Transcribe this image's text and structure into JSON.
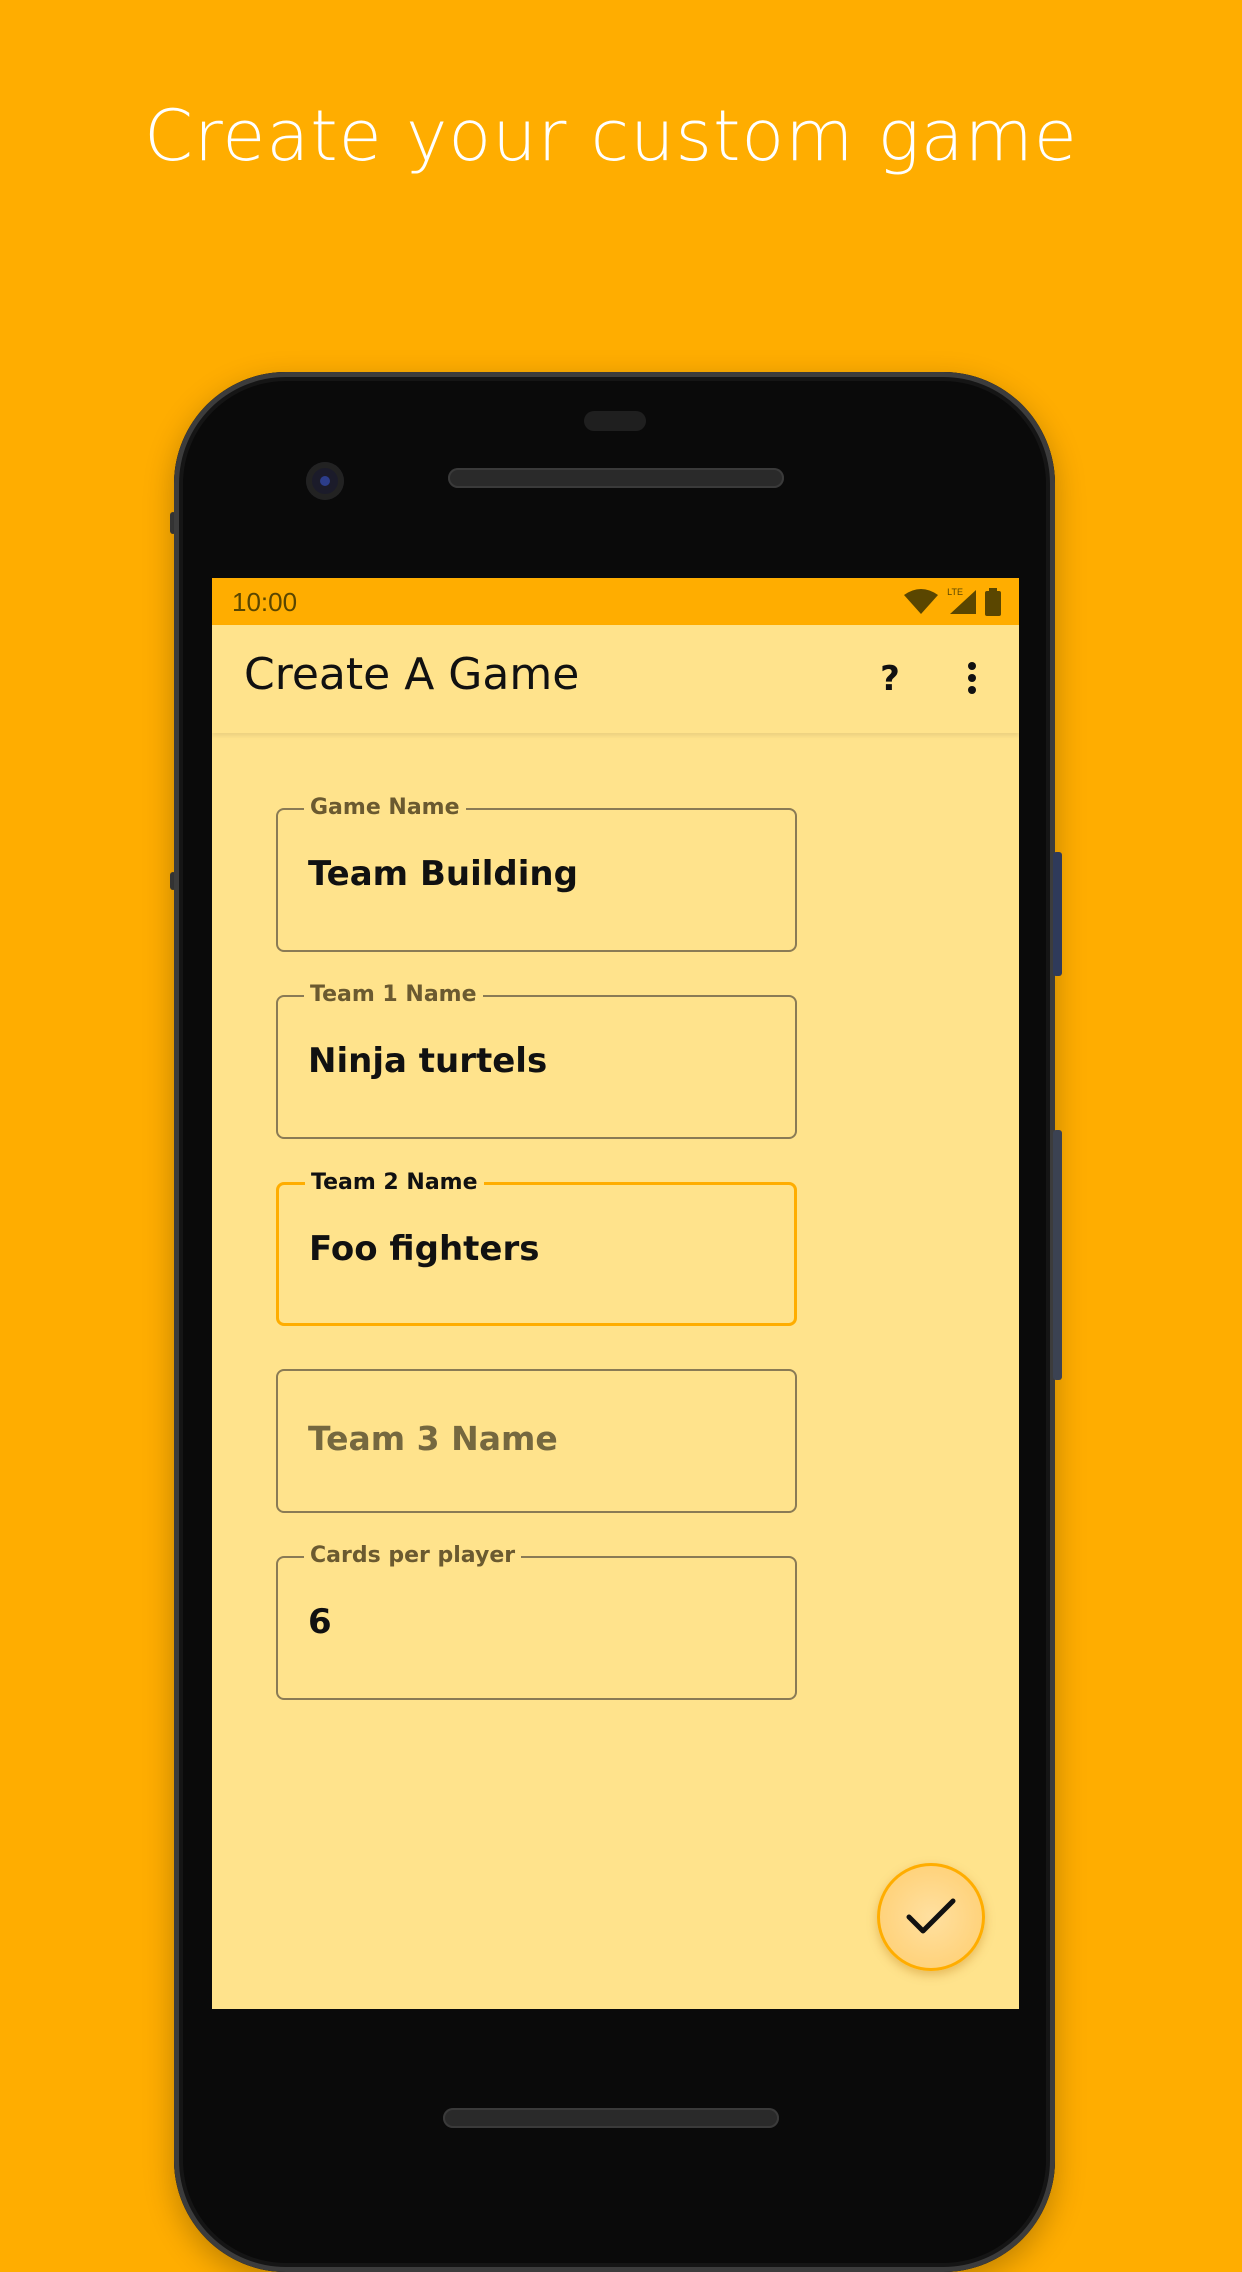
{
  "headline": "Create your custom game",
  "status_bar": {
    "time": "10:00",
    "network": "LTE"
  },
  "app_bar": {
    "title": "Create A Game",
    "help_label": "?"
  },
  "form": {
    "game_name": {
      "label": "Game Name",
      "value": "Team Building"
    },
    "team1": {
      "label": "Team 1 Name",
      "value": "Ninja turtels"
    },
    "team2": {
      "label": "Team 2 Name",
      "value": "Foo fighters"
    },
    "team3": {
      "placeholder": "Team 3 Name"
    },
    "cards_per_player": {
      "label": "Cards per player",
      "value": "6"
    }
  },
  "icons": {
    "wifi": "wifi-icon",
    "signal": "signal-icon",
    "battery": "battery-icon",
    "more": "more-vert-icon",
    "confirm": "check-icon"
  },
  "colors": {
    "background": "#FFAD00",
    "screen": "#FFE38C",
    "accent": "#FFAD00"
  }
}
